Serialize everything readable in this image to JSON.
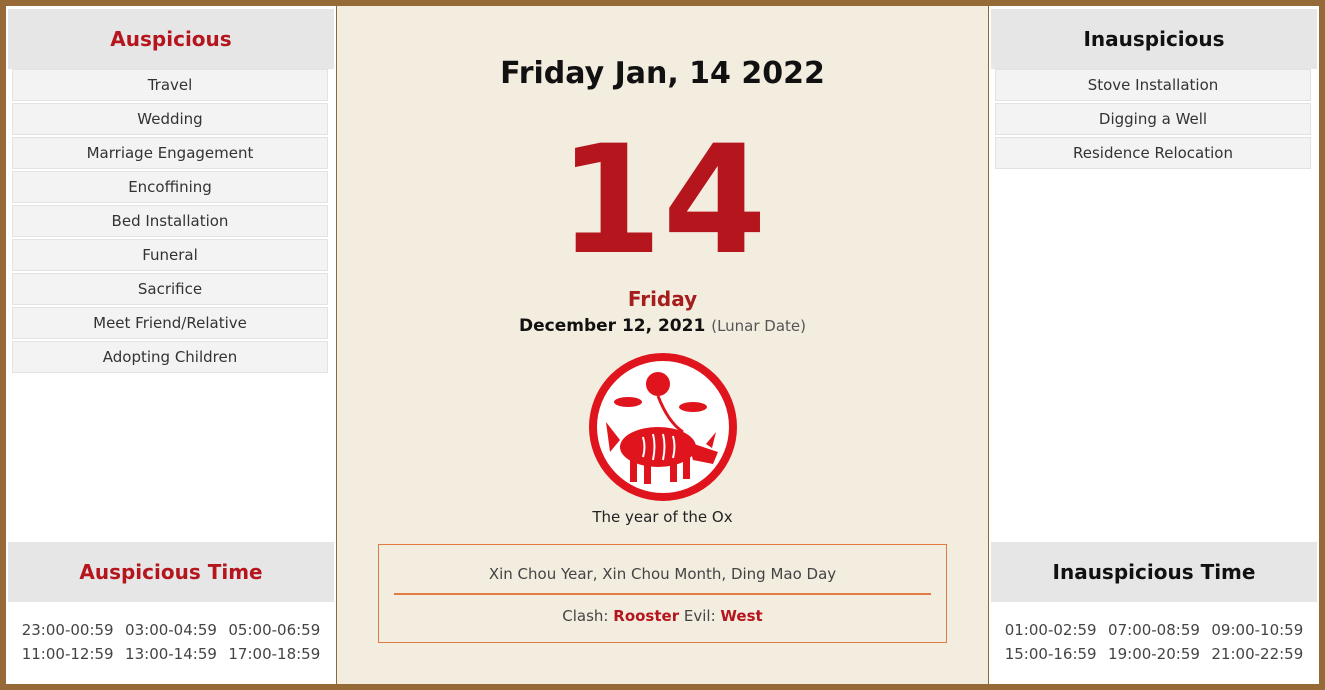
{
  "auspicious": {
    "heading": "Auspicious",
    "items": [
      "Travel",
      "Wedding",
      "Marriage Engagement",
      "Encoffining",
      "Bed Installation",
      "Funeral",
      "Sacrifice",
      "Meet Friend/Relative",
      "Adopting Children"
    ],
    "time_heading": "Auspicious Time",
    "times": [
      "23:00-00:59",
      "03:00-04:59",
      "05:00-06:59",
      "11:00-12:59",
      "13:00-14:59",
      "17:00-18:59"
    ]
  },
  "inauspicious": {
    "heading": "Inauspicious",
    "items": [
      "Stove Installation",
      "Digging a Well",
      "Residence Relocation"
    ],
    "time_heading": "Inauspicious Time",
    "times": [
      "01:00-02:59",
      "07:00-08:59",
      "09:00-10:59",
      "15:00-16:59",
      "19:00-20:59",
      "21:00-22:59"
    ]
  },
  "main": {
    "title": "Friday Jan, 14 2022",
    "day_number": "14",
    "weekday": "Friday",
    "lunar_date": "December 12, 2021",
    "lunar_note": "(Lunar Date)",
    "zodiac_icon": "ox-papercut-icon",
    "zodiac_caption": "The year of the Ox",
    "ganzhi": "Xin Chou Year, Xin Chou Month, Ding Mao Day",
    "clash_label": "Clash:",
    "clash_value": "Rooster",
    "evil_label": "Evil:",
    "evil_value": "West"
  },
  "colors": {
    "accent_red": "#b5151d",
    "border_brown": "#956a36",
    "box_orange": "#e07b45"
  }
}
